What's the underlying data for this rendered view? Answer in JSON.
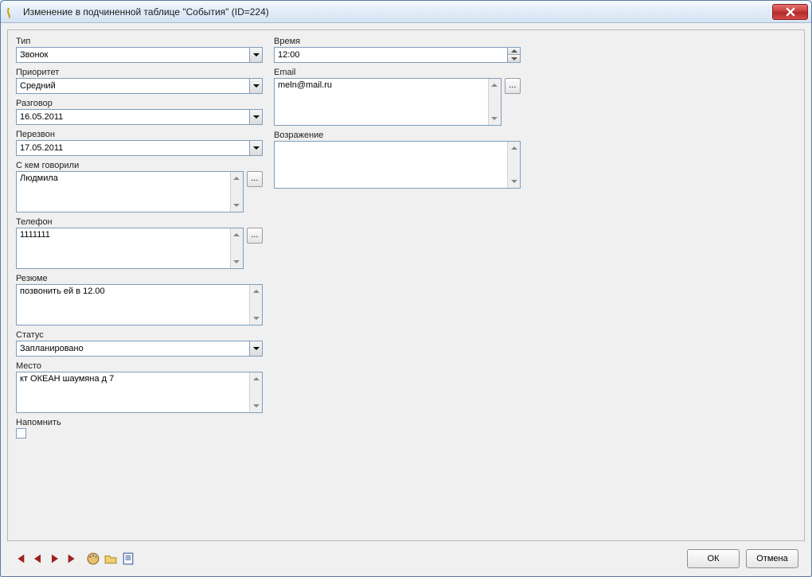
{
  "window": {
    "title": "Изменение в подчиненной таблице \"События\" (ID=224)"
  },
  "left": {
    "type_label": "Тип",
    "type_value": "Звонок",
    "priority_label": "Приоритет",
    "priority_value": "Средний",
    "talk_label": "Разговор",
    "talk_value": "16.05.2011",
    "callback_label": "Перезвон",
    "callback_value": "17.05.2011",
    "spoke_label": "С кем говорили",
    "spoke_value": "Людмила",
    "phone_label": "Телефон",
    "phone_value": "1111111",
    "resume_label": "Резюме",
    "resume_value": "позвонить ей в 12.00",
    "status_label": "Статус",
    "status_value": "Запланировано",
    "place_label": "Место",
    "place_value": "кт ОКЕАН шаумяна д 7",
    "remind_label": "Напомнить"
  },
  "right": {
    "time_label": "Время",
    "time_value": "12:00",
    "email_label": "Email",
    "email_value": "meln@mail.ru",
    "objection_label": "Возражение",
    "objection_value": ""
  },
  "buttons": {
    "ok": "ОК",
    "cancel": "Отмена",
    "ellipsis": "..."
  }
}
